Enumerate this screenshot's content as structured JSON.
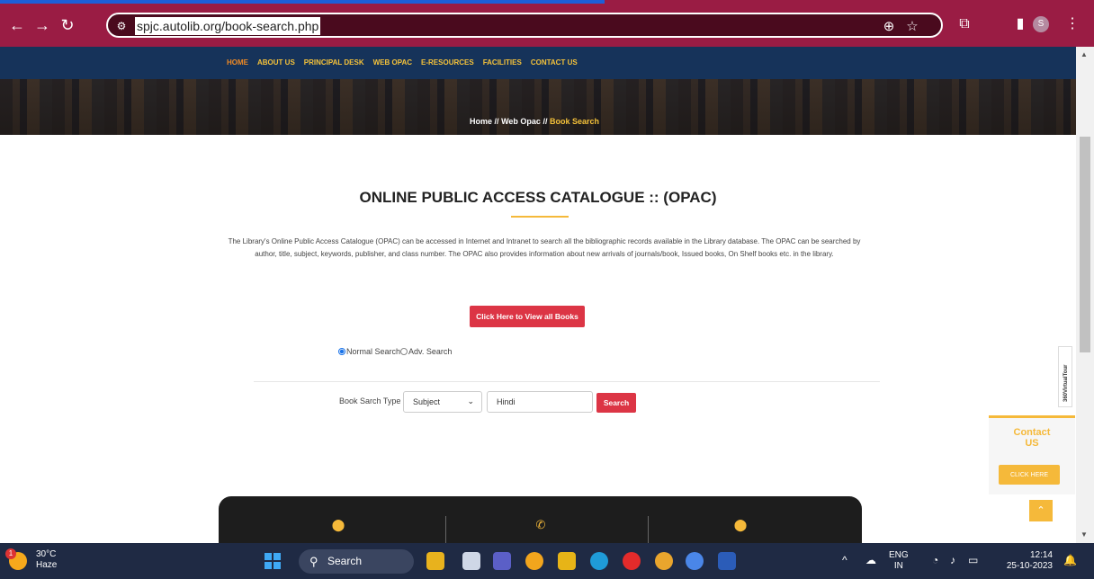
{
  "browser": {
    "url": "spjc.autolib.org/book-search.php",
    "icons": {
      "back": "arrow-left-icon",
      "forward": "arrow-right-icon",
      "reload": "reload-icon",
      "site_info": "tune-icon",
      "zoom": "zoom-icon",
      "bookmark": "star-icon",
      "extensions": "puzzle-icon",
      "sidebar": "sidebar-icon",
      "menu": "kebab-menu-icon"
    },
    "profile_initial": "S",
    "accent_color": "#9a1c44"
  },
  "site_nav": {
    "items": [
      {
        "label": "HOME",
        "active": true
      },
      {
        "label": "ABOUT US",
        "active": false
      },
      {
        "label": "PRINCIPAL DESK",
        "active": false
      },
      {
        "label": "WEB OPAC",
        "active": false
      },
      {
        "label": "E-RESOURCES",
        "active": false
      },
      {
        "label": "FACILITIES",
        "active": false
      },
      {
        "label": "CONTACT US",
        "active": false
      }
    ]
  },
  "breadcrumb": {
    "home": "Home",
    "sep1": "//",
    "web_opac": "Web Opac",
    "sep2": "//",
    "current": "Book Search"
  },
  "main": {
    "title": "ONLINE PUBLIC ACCESS CATALOGUE :: (OPAC)",
    "intro": "The Library's Online Public Access Catalogue (OPAC) can be accessed in Internet and Intranet to search all the bibliographic records available in the Library database. The OPAC can be searched by author, title, subject, keywords, publisher, and class number. The OPAC also provides information about new arrivals of journals/book, Issued books, On Shelf books etc. in the library.",
    "view_all_button": "Click Here to View all Books",
    "search_modes": {
      "normal": "Normal Search",
      "advanced": "Adv. Search",
      "selected": "normal"
    },
    "search_form": {
      "label": "Book Sarch Type",
      "select_value": "Subject",
      "input_value": "Hindi",
      "button": "Search"
    }
  },
  "widgets": {
    "tour_label": "360VirtualTour",
    "contact_title_line1": "Contact",
    "contact_title_line2": "US",
    "contact_button": "CLICK HERE",
    "to_top_icon": "chevron-up-icon",
    "accent_color": "#f5b93a"
  },
  "footer": {
    "icons": [
      "location-pin-icon",
      "phone-icon",
      "location-pin-icon"
    ]
  },
  "taskbar": {
    "weather_temp": "30°C",
    "weather_desc": "Haze",
    "weather_badge": "1",
    "search_label": "Search",
    "language": "ENG",
    "region": "IN",
    "time": "12:14",
    "date": "25-10-2023"
  }
}
